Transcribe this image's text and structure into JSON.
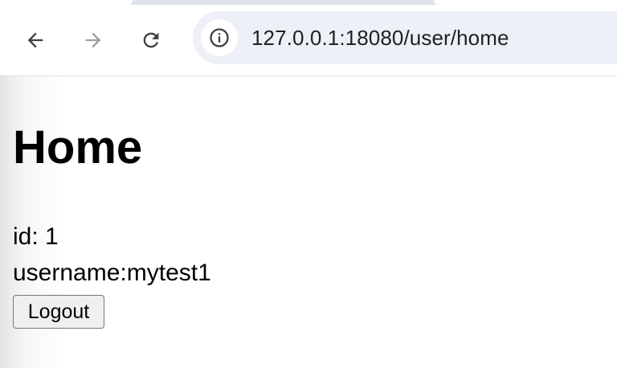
{
  "browser": {
    "url": "127.0.0.1:18080/user/home",
    "icons": {
      "back": "arrow-left-icon",
      "forward": "arrow-right-icon",
      "reload": "reload-icon",
      "site_info": "info-icon"
    },
    "colors": {
      "omnibox_bg": "#edf0f7",
      "forward_disabled": "#9aa0a6"
    }
  },
  "page": {
    "title": "Home",
    "id_label": "id: ",
    "id_value": "1",
    "username_label": "username:",
    "username_value": "mytest1",
    "logout_label": "Logout"
  }
}
